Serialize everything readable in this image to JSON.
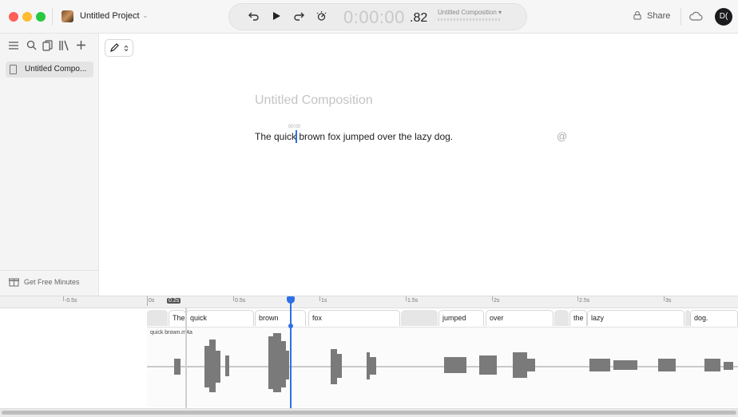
{
  "window": {
    "project_name": "Untitled Project",
    "icons": [
      "close-icon",
      "minimize-icon",
      "zoom-icon",
      "chevron-down-icon"
    ]
  },
  "transport": {
    "timecode_main": "0:00:00",
    "timecode_fraction": ".82",
    "composition_label": "Untitled Composition",
    "icons": [
      "rewind-icon",
      "play-icon",
      "forward-icon",
      "effects-icon"
    ]
  },
  "toolbar": {
    "share_label": "Share",
    "avatar_initials": "D("
  },
  "sidebar": {
    "icons": [
      "menu-icon",
      "search-icon",
      "copy-icon",
      "library-icon",
      "add-icon"
    ],
    "items": [
      {
        "label": "Untitled Compo..."
      }
    ],
    "footer_label": "Get Free Minutes"
  },
  "editor": {
    "title": "Untitled Composition",
    "cursor_time": "00:00",
    "text": "The quick brown fox jumped over the lazy dog."
  },
  "timeline": {
    "ruler": [
      "-0.5s",
      "0s",
      "0.2s",
      "0.5s",
      "1s",
      "1.5s",
      "2s",
      "2.5s",
      "3s"
    ],
    "words": [
      "The",
      "quick",
      "brown",
      "fox",
      "jumped",
      "over",
      "the",
      "lazy",
      "dog."
    ],
    "clip_label": "quick brown.m4a"
  }
}
